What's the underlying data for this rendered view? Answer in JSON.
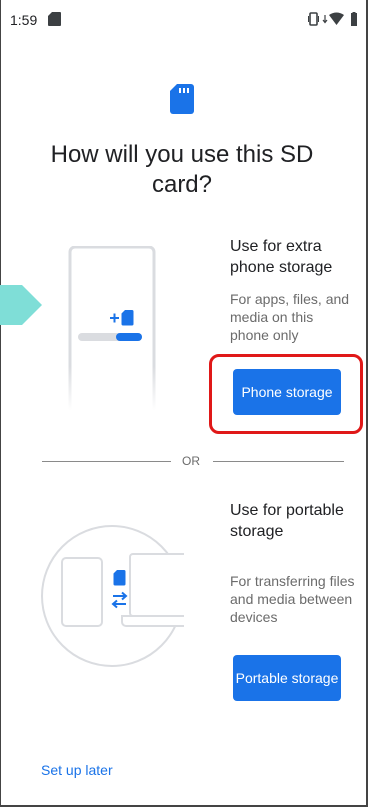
{
  "status_bar": {
    "time": "1:59",
    "icons": [
      "sd-card-icon",
      "vibrate-icon",
      "data-arrows-icon",
      "wifi-icon",
      "battery-icon"
    ]
  },
  "header": {
    "icon": "sd-card-icon",
    "title": "How will you use this SD card?"
  },
  "phone_storage": {
    "heading": "Use for extra phone storage",
    "description": "For apps, files, and media on this phone only",
    "button_label": "Phone storage",
    "illustration_icons": [
      "phone-outline",
      "plus-icon",
      "sd-card-icon",
      "storage-progress-bar"
    ]
  },
  "divider": {
    "label": "OR"
  },
  "portable_storage": {
    "heading": "Use for portable storage",
    "description": "For transferring files and media between devices",
    "button_label": "Portable storage",
    "illustration_icons": [
      "phone-outline",
      "laptop-outline",
      "sd-card-icon",
      "transfer-arrows-icon"
    ]
  },
  "footer": {
    "setup_later_label": "Set up later"
  },
  "colors": {
    "accent": "#1a73e8",
    "highlight": "#e01818",
    "marker": "#7fded7",
    "illustration": "#dadce0"
  }
}
